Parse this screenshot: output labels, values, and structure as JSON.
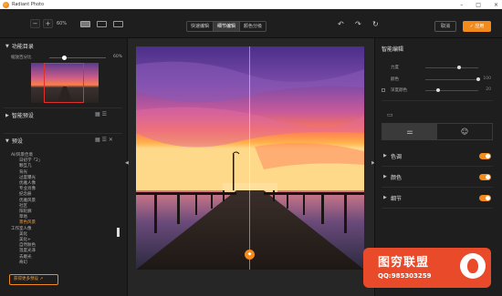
{
  "window": {
    "title": "Radiant Photo",
    "minimize": "–",
    "maximize": "□",
    "close": "×"
  },
  "toolbar": {
    "zoom_out": "−",
    "zoom_in": "+",
    "zoom_level": "60%",
    "tabs": [
      {
        "label": "快速编辑",
        "active": false
      },
      {
        "label": "细节编辑",
        "active": true
      },
      {
        "label": "颜色分级",
        "active": false
      }
    ],
    "undo": "↶",
    "redo": "↷",
    "reset": "↻",
    "cancel_label": "取消",
    "apply_label": "✓ 应用"
  },
  "left": {
    "feature_section": {
      "title": "功能目录",
      "slider_label": "缩放百分比",
      "slider_value": "60%"
    },
    "smart_presets": {
      "title": "智能预设"
    },
    "presets": {
      "title": "预设",
      "items": [
        {
          "label": "AI/风景佳境",
          "level": 1,
          "selected": false
        },
        {
          "label": "日初学「2」",
          "level": 2,
          "selected": false
        },
        {
          "label": "颗互几",
          "level": 2,
          "selected": false
        },
        {
          "label": "背光",
          "level": 2,
          "selected": false
        },
        {
          "label": "过度曝光",
          "level": 2,
          "selected": false
        },
        {
          "label": "优雅人像",
          "level": 2,
          "selected": false
        },
        {
          "label": "专业肖像",
          "level": 2,
          "selected": false
        },
        {
          "label": "纪念册",
          "level": 2,
          "selected": false
        },
        {
          "label": "优雅风景",
          "level": 2,
          "selected": false
        },
        {
          "label": "社区",
          "level": 2,
          "selected": false
        },
        {
          "label": "阳轮廓",
          "level": 2,
          "selected": false
        },
        {
          "label": "草地",
          "level": 2,
          "selected": false
        },
        {
          "label": "景色风景",
          "level": 2,
          "selected": true
        },
        {
          "label": "工作室人像",
          "level": 1,
          "selected": false
        },
        {
          "label": "美化",
          "level": 2,
          "selected": false
        },
        {
          "label": "美化+",
          "level": 2,
          "selected": false
        },
        {
          "label": "自然肤色",
          "level": 2,
          "selected": false
        },
        {
          "label": "温度光泽",
          "level": 2,
          "selected": false
        },
        {
          "label": "去磨光",
          "level": 2,
          "selected": false
        },
        {
          "label": "奇幻",
          "level": 2,
          "selected": false
        }
      ],
      "more_button": "获得更多预设"
    }
  },
  "right": {
    "title": "智能编辑",
    "adjustments": [
      {
        "label": "力度",
        "value": "",
        "level": 0.6,
        "checkbox": false
      },
      {
        "label": "颜色",
        "value": "100",
        "level": 1.0,
        "checkbox": false
      },
      {
        "label": "深度颜色",
        "value": "20",
        "level": 0.2,
        "checkbox": true
      }
    ],
    "features": [
      {
        "label": "色调",
        "on": true
      },
      {
        "label": "颜色",
        "on": true
      },
      {
        "label": "细节",
        "on": true
      }
    ]
  },
  "watermark": {
    "title": "图穷联盟",
    "subtitle": "QQ:985303259"
  },
  "colors": {
    "accent": "#f28a1c",
    "panel_bg": "#1e1e1e",
    "canvas_bg": "#262626"
  }
}
